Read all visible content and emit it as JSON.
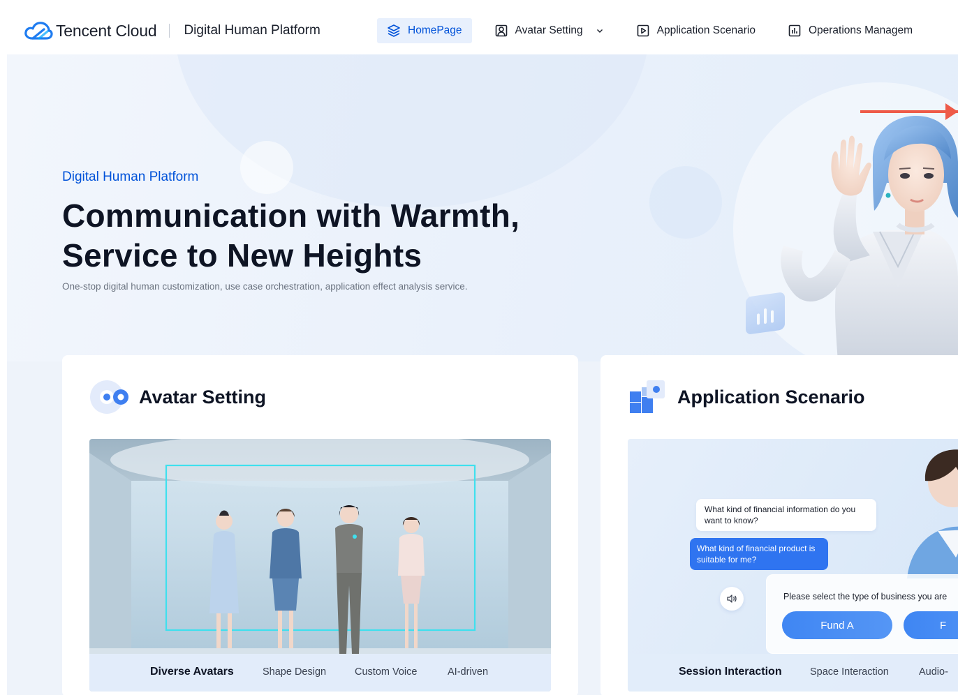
{
  "header": {
    "brand_name": "Tencent Cloud",
    "separator": "|",
    "product_name": "Digital Human Platform",
    "nav": [
      {
        "label": "HomePage",
        "icon": "layers-icon",
        "active": true
      },
      {
        "label": "Avatar Setting",
        "icon": "user-portrait-icon",
        "has_dropdown": true
      },
      {
        "label": "Application Scenario",
        "icon": "play-square-icon"
      },
      {
        "label": "Operations Managem",
        "icon": "bar-chart-icon"
      }
    ]
  },
  "hero": {
    "tag": "Digital Human Platform",
    "title_line1": "Communication with Warmth,",
    "title_line2": "Service to New Heights",
    "description": "One-stop digital human customization, use case orchestration, application effect analysis service."
  },
  "avatar_card": {
    "title": "Avatar Setting",
    "tabs": [
      "Diverse Avatars",
      "Shape Design",
      "Custom Voice",
      "AI-driven"
    ],
    "active_tab": 0
  },
  "scenario_card": {
    "title": "Application Scenario",
    "tabs": [
      "Session Interaction",
      "Space Interaction",
      "Audio-"
    ],
    "active_tab": 0,
    "chat_question": "What kind of financial information do you want to know?",
    "chat_reply": "What kind of financial product is suitable for me?",
    "select_prompt": "Please select the type of business you are",
    "options": [
      "Fund A",
      "F"
    ]
  },
  "colors": {
    "accent": "#0052d9",
    "nav_active_bg": "#e8f0fd",
    "arrow": "#ee5a48",
    "button": "#3f86f3"
  }
}
